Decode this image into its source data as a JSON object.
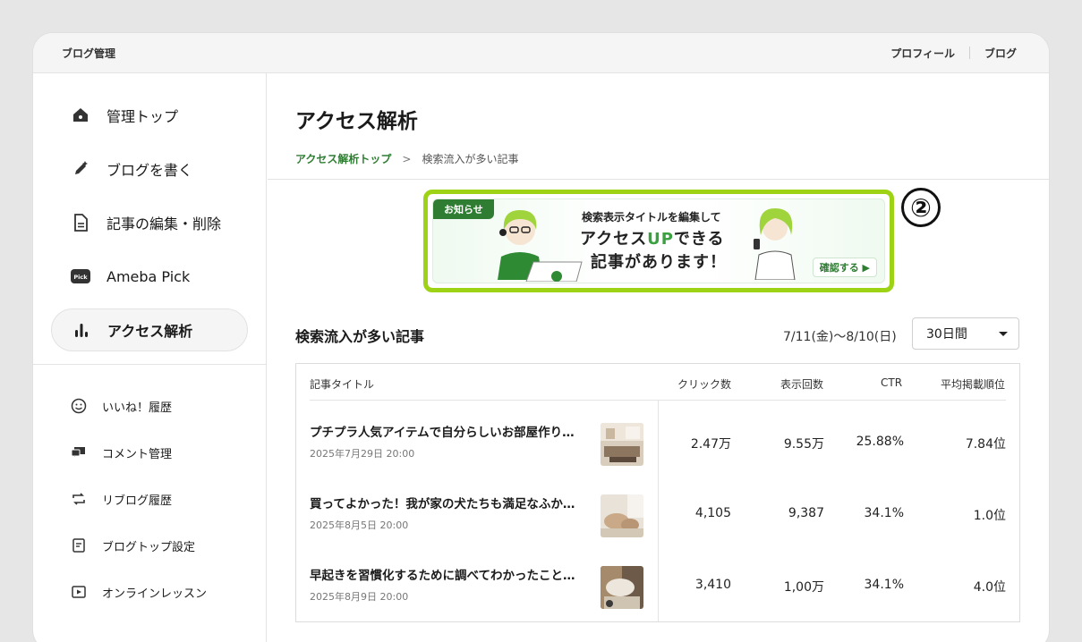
{
  "topbar": {
    "title": "ブログ管理",
    "links": [
      "プロフィール",
      "ブログ"
    ]
  },
  "sidebar": {
    "main_items": [
      {
        "label": "管理トップ",
        "icon": "home-icon"
      },
      {
        "label": "ブログを書く",
        "icon": "pen-icon"
      },
      {
        "label": "記事の編集・削除",
        "icon": "document-icon"
      },
      {
        "label": "Ameba Pick",
        "icon": "pick-icon",
        "icon_text": "Pick"
      },
      {
        "label": "アクセス解析",
        "icon": "bar-chart-icon",
        "active": true
      }
    ],
    "sub_items": [
      {
        "label": "いいね！履歴",
        "icon": "smile-icon"
      },
      {
        "label": "コメント管理",
        "icon": "comment-icon"
      },
      {
        "label": "リブログ履歴",
        "icon": "reblog-icon"
      },
      {
        "label": "ブログトップ設定",
        "icon": "settings-doc-icon"
      },
      {
        "label": "オンラインレッスン",
        "icon": "video-icon"
      }
    ]
  },
  "main": {
    "title": "アクセス解析",
    "breadcrumb": {
      "link": "アクセス解析トップ",
      "current": "検索流入が多い記事"
    },
    "banner": {
      "badge": "お知らせ",
      "line1": "検索表示タイトルを編集して",
      "line2_pre": "アクセス",
      "line2_up": "UP",
      "line2_post": "できる",
      "line3": "記事があります！",
      "button": "確認する ▶"
    },
    "marker": "②",
    "section_title": "検索流入が多い記事",
    "date_range": "7/11(金)〜8/10(日)",
    "period_select": "30日間",
    "table": {
      "headers": [
        "記事タイトル",
        "クリック数",
        "表示回数",
        "CTR",
        "平均掲載順位"
      ],
      "rows": [
        {
          "title": "プチプラ人気アイテムで自分らしいお部屋作り…",
          "date": "2025年7月29日 20:00",
          "clicks": "2.47万",
          "impressions": "9.55万",
          "ctr": "25.88%",
          "rank": "7.84位"
        },
        {
          "title": "買ってよかった！我が家の犬たちも満足なふか…",
          "date": "2025年8月5日 20:00",
          "clicks": "4,105",
          "impressions": "9,387",
          "ctr": "34.1%",
          "rank": "1.0位"
        },
        {
          "title": "早起きを習慣化するために調べてわかったこと…",
          "date": "2025年8月9日 20:00",
          "clicks": "3,410",
          "impressions": "1,00万",
          "ctr": "34.1%",
          "rank": "4.0位"
        }
      ]
    }
  },
  "colors": {
    "accent_green": "#2e7d32",
    "highlight": "#9dd314"
  }
}
